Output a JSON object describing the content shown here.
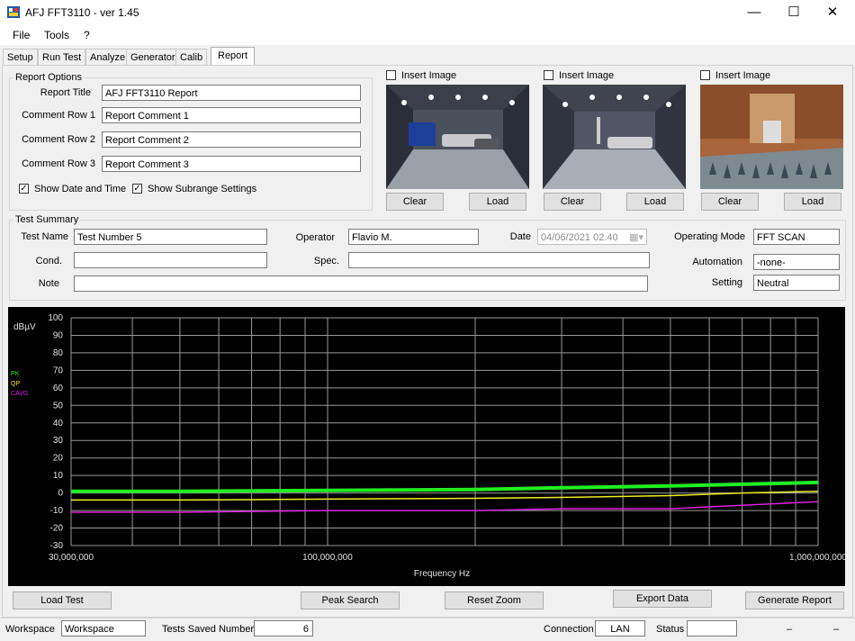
{
  "window": {
    "title": "AFJ FFT3110 - ver 1.45",
    "minimize": "—",
    "maximize": "☐",
    "close": "✕"
  },
  "menu": {
    "items": [
      "File",
      "Tools",
      "?"
    ]
  },
  "tabs": [
    "Setup",
    "Run Test",
    "Analyze",
    "Generator",
    "Calib",
    "Report"
  ],
  "report_options": {
    "group_label": "Report Options",
    "title_label": "Report Title",
    "title_value": "AFJ FFT3110 Report",
    "row1_label": "Comment Row 1",
    "row1_value": "Report Comment 1",
    "row2_label": "Comment Row 2",
    "row2_value": "Report Comment 2",
    "row3_label": "Comment Row 3",
    "row3_value": "Report Comment 3",
    "show_date_label": "Show Date and Time",
    "show_subrange_label": "Show Subrange Settings",
    "show_date_checked": "✓",
    "show_subrange_checked": "✓"
  },
  "images": [
    {
      "insert_label": "Insert Image",
      "clear_label": "Clear",
      "load_label": "Load"
    },
    {
      "insert_label": "Insert Image",
      "clear_label": "Clear",
      "load_label": "Load"
    },
    {
      "insert_label": "Insert Image",
      "clear_label": "Clear",
      "load_label": "Load"
    }
  ],
  "test_summary": {
    "group_label": "Test Summary",
    "test_name_label": "Test Name",
    "test_name_value": "Test Number 5",
    "operator_label": "Operator",
    "operator_value": "Flavio M.",
    "date_label": "Date",
    "date_value": "04/06/2021 02.40",
    "operating_mode_label": "Operating Mode",
    "operating_mode_value": "FFT SCAN",
    "cond_label": "Cond.",
    "cond_value": "",
    "spec_label": "Spec.",
    "spec_value": "",
    "automation_label": "Automation",
    "automation_value": "-none-",
    "note_label": "Note",
    "note_value": "",
    "setting_label": "Setting",
    "setting_value": "Neutral"
  },
  "chart_data": {
    "type": "line",
    "xlabel": "Frequency Hz",
    "ylabel": "dBµV",
    "xscale": "log",
    "xlim": [
      30000000,
      1000000000
    ],
    "ylim": [
      -30,
      100
    ],
    "x_tick_labels": [
      "30,000,000",
      "100,000,000",
      "1,000,000,000"
    ],
    "y_tick_labels": [
      "100",
      "90",
      "80",
      "70",
      "60",
      "50",
      "40",
      "30",
      "20",
      "10",
      "0",
      "-10",
      "-20",
      "-30"
    ],
    "grid": true,
    "legend_position": "left",
    "series": [
      {
        "name": "PK",
        "color": "#22ee22",
        "x": [
          30000000,
          50000000,
          100000000,
          200000000,
          300000000,
          500000000,
          700000000,
          1000000000
        ],
        "y": [
          1,
          1,
          1.5,
          2,
          3,
          4,
          5,
          6
        ]
      },
      {
        "name": "QP",
        "color": "#eeee22",
        "x": [
          30000000,
          50000000,
          100000000,
          200000000,
          300000000,
          500000000,
          700000000,
          1000000000
        ],
        "y": [
          -4,
          -4,
          -3.5,
          -3,
          -2.5,
          -1.5,
          0,
          1
        ]
      },
      {
        "name": "CAVG",
        "color": "#dd22dd",
        "x": [
          30000000,
          50000000,
          100000000,
          200000000,
          300000000,
          500000000,
          700000000,
          1000000000
        ],
        "y": [
          -11,
          -11,
          -10,
          -10,
          -9,
          -9,
          -7,
          -5
        ]
      }
    ]
  },
  "buttons": {
    "load_test": "Load Test",
    "peak_search": "Peak Search",
    "reset_zoom": "Reset Zoom",
    "export_data": "Export Data",
    "generate_report": "Generate Report"
  },
  "statusbar": {
    "workspace_label": "Workspace",
    "workspace_value": "Workspace",
    "tests_saved_label": "Tests Saved Number",
    "tests_saved_value": "6",
    "connection_label": "Connection",
    "connection_value": "LAN",
    "status_label": "Status",
    "status_value": "",
    "dash1": "–",
    "dash2": "–"
  }
}
